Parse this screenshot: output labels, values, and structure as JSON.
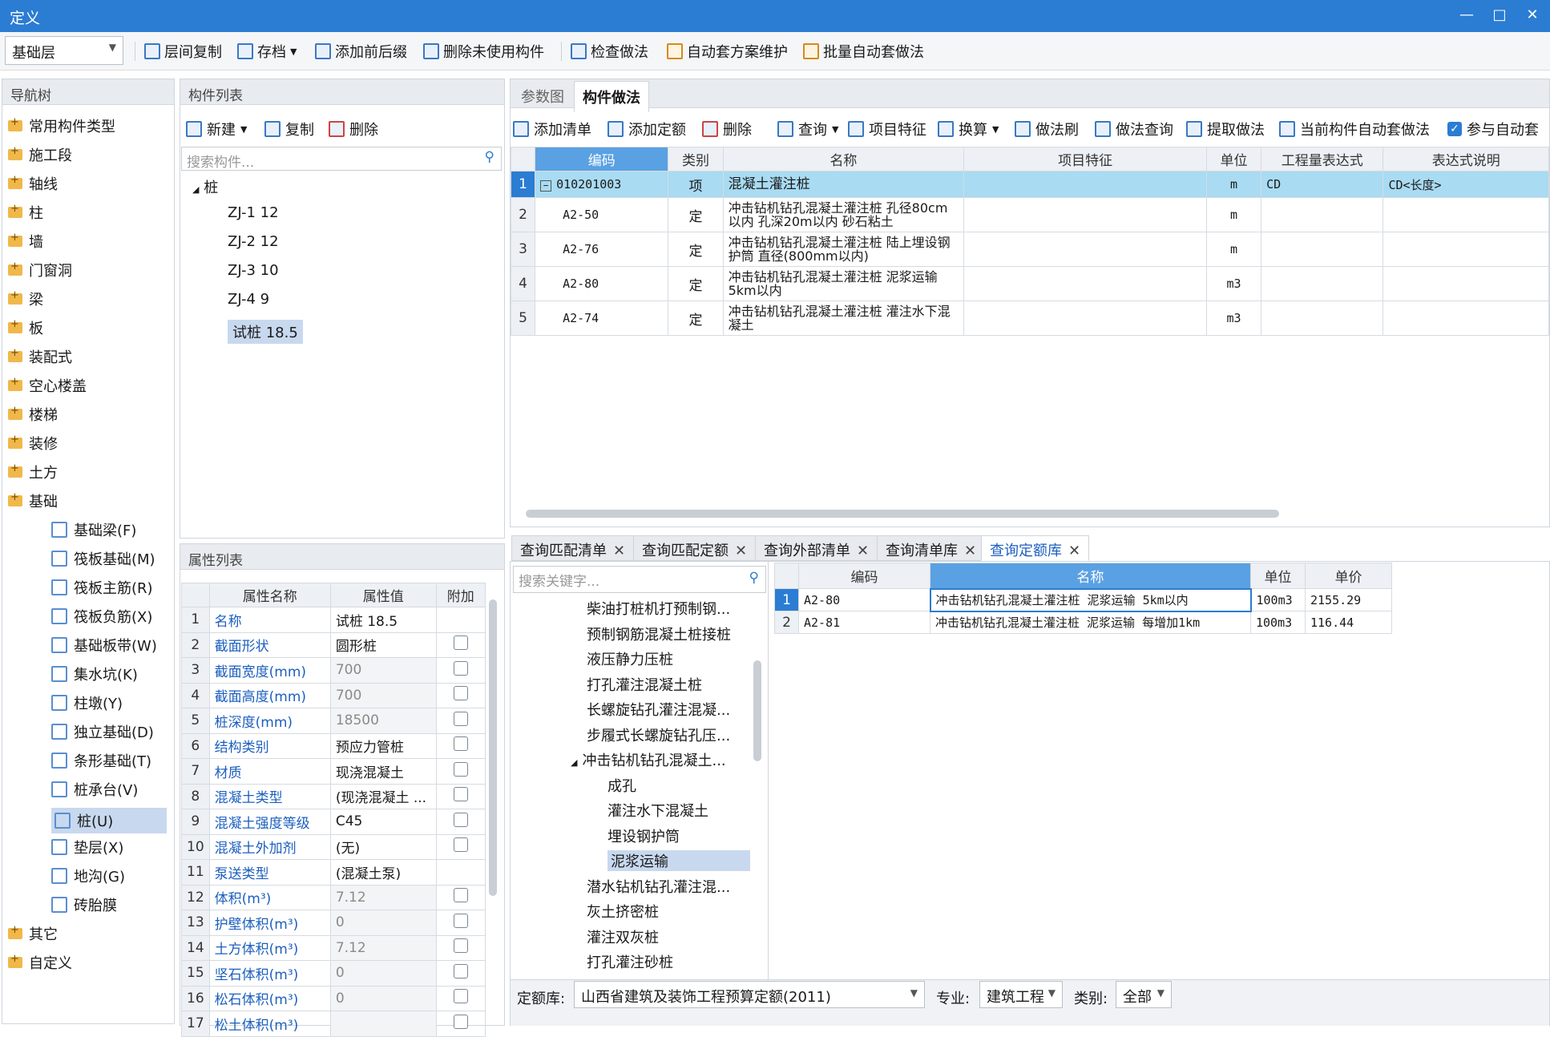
{
  "window": {
    "title": "定义"
  },
  "toolbar": {
    "floor": "基础层",
    "buttons": [
      "层间复制",
      "存档",
      "添加前后缀",
      "删除未使用构件",
      "检查做法",
      "自动套方案维护",
      "批量自动套做法"
    ]
  },
  "nav": {
    "header": "导航树",
    "top_items": [
      "常用构件类型",
      "施工段",
      "轴线",
      "柱",
      "墙",
      "门窗洞",
      "梁",
      "板",
      "装配式",
      "空心楼盖",
      "楼梯",
      "装修",
      "土方",
      "基础"
    ],
    "sub_items": [
      "基础梁(F)",
      "筏板基础(M)",
      "筏板主筋(R)",
      "筏板负筋(X)",
      "基础板带(W)",
      "集水坑(K)",
      "柱墩(Y)",
      "独立基础(D)",
      "条形基础(T)",
      "桩承台(V)",
      "桩(U)",
      "垫层(X)",
      "地沟(G)",
      "砖胎膜"
    ],
    "bottom_items": [
      "其它",
      "自定义"
    ]
  },
  "components": {
    "header": "构件列表",
    "new_label": "新建",
    "copy_label": "复制",
    "delete_label": "删除",
    "search_placeholder": "搜索构件...",
    "root": "桩",
    "items": [
      "ZJ-1 12",
      "ZJ-2 12",
      "ZJ-3 10",
      "ZJ-4 9",
      "试桩 18.5"
    ]
  },
  "properties": {
    "header": "属性列表",
    "columns": [
      "属性名称",
      "属性值",
      "附加"
    ],
    "rows": [
      {
        "n": "1",
        "name": "名称",
        "value": "试桩 18.5"
      },
      {
        "n": "2",
        "name": "截面形状",
        "value": "圆形桩"
      },
      {
        "n": "3",
        "name": "截面宽度(mm)",
        "value": "700"
      },
      {
        "n": "4",
        "name": "截面高度(mm)",
        "value": "700"
      },
      {
        "n": "5",
        "name": "桩深度(mm)",
        "value": "18500"
      },
      {
        "n": "6",
        "name": "结构类别",
        "value": "预应力管桩"
      },
      {
        "n": "7",
        "name": "材质",
        "value": "现浇混凝土"
      },
      {
        "n": "8",
        "name": "混凝土类型",
        "value": "(现浇混凝土 ..."
      },
      {
        "n": "9",
        "name": "混凝土强度等级",
        "value": "C45"
      },
      {
        "n": "10",
        "name": "混凝土外加剂",
        "value": "(无)"
      },
      {
        "n": "11",
        "name": "泵送类型",
        "value": "(混凝土泵)"
      },
      {
        "n": "12",
        "name": "体积(m³)",
        "value": "7.12"
      },
      {
        "n": "13",
        "name": "护壁体积(m³)",
        "value": "0"
      },
      {
        "n": "14",
        "name": "土方体积(m³)",
        "value": "7.12"
      },
      {
        "n": "15",
        "name": "坚石体积(m³)",
        "value": "0"
      },
      {
        "n": "16",
        "name": "松石体积(m³)",
        "value": "0"
      },
      {
        "n": "17",
        "name": "松土体积(m³)",
        "value": ""
      }
    ]
  },
  "method": {
    "tabs": [
      "参数图",
      "构件做法"
    ],
    "buttons": [
      "添加清单",
      "添加定额",
      "删除",
      "查询",
      "项目特征",
      "换算",
      "做法刷",
      "做法查询",
      "提取做法",
      "当前构件自动套做法",
      "参与自动套"
    ],
    "columns": [
      "编码",
      "类别",
      "名称",
      "项目特征",
      "单位",
      "工程量表达式",
      "表达式说明"
    ],
    "rows": [
      {
        "n": "1",
        "code": "010201003",
        "type": "项",
        "name": "混凝土灌注桩",
        "unit": "m",
        "expr": "CD",
        "desc": "CD<长度>"
      },
      {
        "n": "2",
        "code": "A2-50",
        "type": "定",
        "name": "冲击钻机钻孔混凝土灌注桩 孔径80cm以内 孔深20m以内 砂石粘土",
        "unit": "m",
        "expr": "",
        "desc": ""
      },
      {
        "n": "3",
        "code": "A2-76",
        "type": "定",
        "name": "冲击钻机钻孔混凝土灌注桩 陆上埋设钢护筒 直径(800mm以内)",
        "unit": "m",
        "expr": "",
        "desc": ""
      },
      {
        "n": "4",
        "code": "A2-80",
        "type": "定",
        "name": "冲击钻机钻孔混凝土灌注桩 泥浆运输 5km以内",
        "unit": "m3",
        "expr": "",
        "desc": ""
      },
      {
        "n": "5",
        "code": "A2-74",
        "type": "定",
        "name": "冲击钻机钻孔混凝土灌注桩 灌注水下混凝土",
        "unit": "m3",
        "expr": "",
        "desc": ""
      }
    ]
  },
  "query": {
    "tabs": [
      "查询匹配清单",
      "查询匹配定额",
      "查询外部清单",
      "查询清单库",
      "查询定额库"
    ],
    "search_placeholder": "搜索关键字...",
    "tree": [
      "柴油打桩机打预制钢...",
      "预制钢筋混凝土桩接桩",
      "液压静力压桩",
      "打孔灌注混凝土桩",
      "长螺旋钻孔灌注混凝...",
      "步履式长螺旋钻孔压...",
      "冲击钻机钻孔混凝土..."
    ],
    "tree_children": [
      "成孔",
      "灌注水下混凝土",
      "埋设钢护筒",
      "泥浆运输"
    ],
    "tree_after": [
      "潜水钻机钻孔灌注混...",
      "灰土挤密桩",
      "灌注双灰桩",
      "打孔灌注砂桩"
    ],
    "columns": [
      "编码",
      "名称",
      "单位",
      "单价"
    ],
    "rows": [
      {
        "n": "1",
        "code": "A2-80",
        "name": "冲击钻机钻孔混凝土灌注桩 泥浆运输 5km以内",
        "unit": "100m3",
        "price": "2155.29"
      },
      {
        "n": "2",
        "code": "A2-81",
        "name": "冲击钻机钻孔混凝土灌注桩 泥浆运输 每增加1km",
        "unit": "100m3",
        "price": "116.44"
      }
    ],
    "lib_label": "定额库:",
    "lib_value": "山西省建筑及装饰工程预算定额(2011)",
    "major_label": "专业:",
    "major_value": "建筑工程",
    "cat_label": "类别:",
    "cat_value": "全部"
  }
}
